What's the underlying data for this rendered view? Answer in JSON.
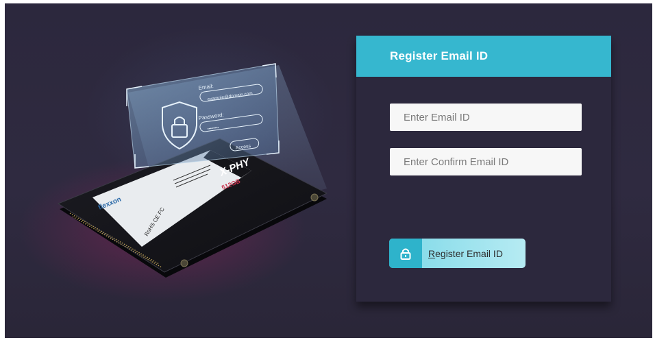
{
  "register": {
    "title": "Register Email ID",
    "email_placeholder": "Enter Email ID",
    "confirm_placeholder": "Enter Confirm Email ID",
    "button_label_first": "R",
    "button_label_rest": "egister Email ID",
    "button_icon": "lock-icon"
  },
  "illustration": {
    "email_label": "Email:",
    "email_value": "example@domain.com",
    "password_label": "Password:",
    "password_value": "••••••••",
    "access_label": "Access",
    "shield_icon": "shield-lock-icon",
    "brand": "X-PHY",
    "capacity": "512GB",
    "maker": "flexxon",
    "cert": "RoHS CE FC"
  },
  "colors": {
    "accent": "#36b7cf",
    "background": "#2c283d",
    "button_gradient_start": "#7dd8e7"
  }
}
